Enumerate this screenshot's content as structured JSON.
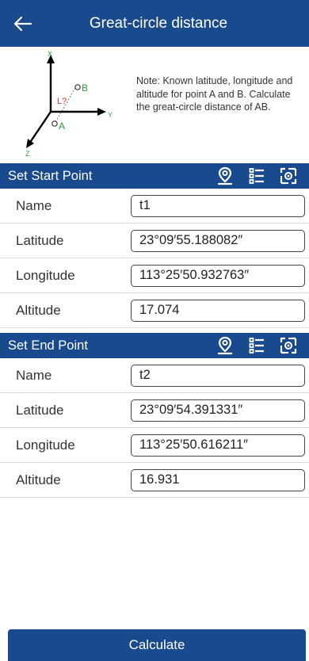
{
  "header": {
    "title": "Great-circle distance",
    "back_icon": "arrow-left-icon"
  },
  "diagram": {
    "axis_x": "X",
    "axis_y": "Y",
    "axis_z": "Z",
    "point_a": "A",
    "point_b": "B",
    "line_label": "L?"
  },
  "note": "Note: Known latitude, longitude and altitude for point A and B. Calculate the great-circle distance of AB.",
  "start": {
    "title": "Set Start Point",
    "icons": [
      "location-pin-icon",
      "list-icon",
      "scan-icon"
    ],
    "name_label": "Name",
    "name_value": "t1",
    "lat_label": "Latitude",
    "lat_value": "23°09′55.188082″",
    "lon_label": "Longitude",
    "lon_value": "113°25′50.932763″",
    "alt_label": "Altitude",
    "alt_value": "17.074"
  },
  "end": {
    "title": "Set End Point",
    "icons": [
      "location-pin-icon",
      "list-icon",
      "scan-icon"
    ],
    "name_label": "Name",
    "name_value": "t2",
    "lat_label": "Latitude",
    "lat_value": "23°09′54.391331″",
    "lon_label": "Longitude",
    "lon_value": "113°25′50.616211″",
    "alt_label": "Altitude",
    "alt_value": "16.931"
  },
  "calculate_label": "Calculate",
  "colors": {
    "primary": "#1a4a8e",
    "diagram_line": "#d0342c",
    "diagram_points": "#2e9a3c"
  }
}
